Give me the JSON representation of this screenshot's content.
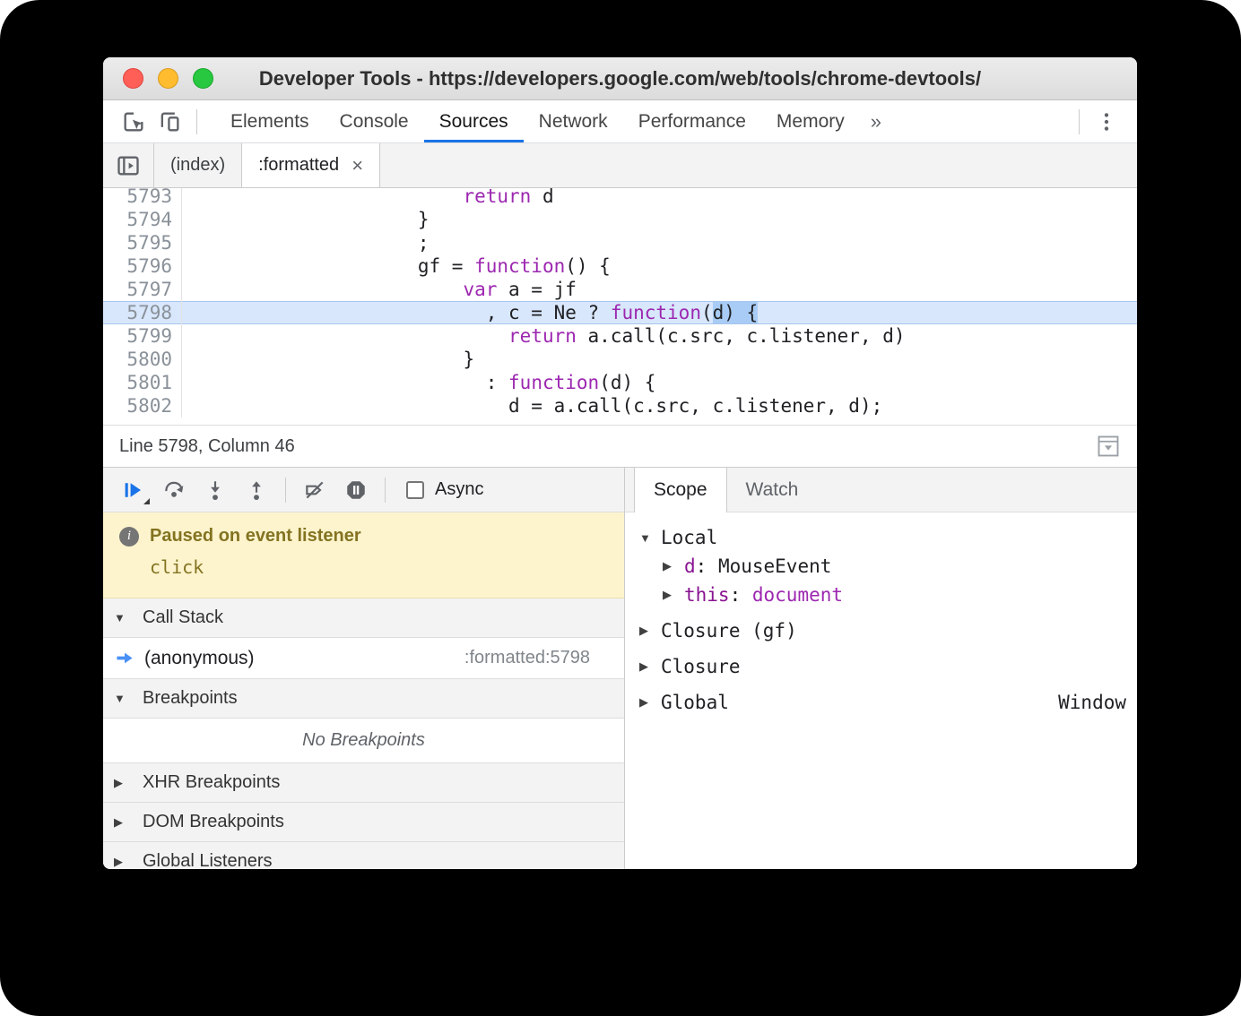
{
  "glyphs": {
    "triangle_down": "▼",
    "triangle_right": "▶",
    "close": "×",
    "overflow_chevron": "»",
    "kebab_menu": "⋮"
  },
  "colors": {
    "accent-blue": "#1a73e8",
    "icon-gray": "#5f6368",
    "keyword-purple": "#9c27b0",
    "scope-name-purple": "#881391",
    "exec-line-bg": "#d8e7fc",
    "exec-line-border": "#a6c5ec",
    "selection-bg": "#a8ccf5",
    "paused-bg": "#fdf4cd",
    "paused-border": "#e8dfae",
    "paused-text": "#837321"
  },
  "window": {
    "title": "Developer Tools - https://developers.google.com/web/tools/chrome-devtools/"
  },
  "main_toolbar": {
    "tabs": [
      {
        "label": "Elements",
        "active": false
      },
      {
        "label": "Console",
        "active": false
      },
      {
        "label": "Sources",
        "active": true
      },
      {
        "label": "Network",
        "active": false
      },
      {
        "label": "Performance",
        "active": false
      },
      {
        "label": "Memory",
        "active": false
      }
    ]
  },
  "file_tabs": [
    {
      "label": "(index)",
      "active": false,
      "closable": false
    },
    {
      "label": ":formatted",
      "active": true,
      "closable": true
    }
  ],
  "editor": {
    "lines": [
      {
        "n": "5793",
        "highlight": false,
        "tokens": [
          [
            "                        ",
            "p"
          ],
          [
            "return",
            "k"
          ],
          [
            " d",
            "p"
          ]
        ]
      },
      {
        "n": "5794",
        "highlight": false,
        "tokens": [
          [
            "                    ",
            "p"
          ],
          [
            "}",
            "p"
          ]
        ]
      },
      {
        "n": "5795",
        "highlight": false,
        "tokens": [
          [
            "                    ",
            "p"
          ],
          [
            ";",
            "p"
          ]
        ]
      },
      {
        "n": "5796",
        "highlight": false,
        "tokens": [
          [
            "                    ",
            "p"
          ],
          [
            "gf = ",
            "p"
          ],
          [
            "function",
            "k"
          ],
          [
            "() {",
            "p"
          ]
        ]
      },
      {
        "n": "5797",
        "highlight": false,
        "tokens": [
          [
            "                        ",
            "p"
          ],
          [
            "var",
            "k"
          ],
          [
            " a = jf",
            "p"
          ]
        ]
      },
      {
        "n": "5798",
        "highlight": true,
        "tokens": [
          [
            "                          ",
            "p"
          ],
          [
            ", c = Ne ? ",
            "p"
          ],
          [
            "function",
            "k"
          ],
          [
            "(",
            "p"
          ],
          [
            "d) {",
            "sel"
          ]
        ]
      },
      {
        "n": "5799",
        "highlight": false,
        "tokens": [
          [
            "                            ",
            "p"
          ],
          [
            "return",
            "k"
          ],
          [
            " a.call(c.src, c.listener, d)",
            "p"
          ]
        ]
      },
      {
        "n": "5800",
        "highlight": false,
        "tokens": [
          [
            "                        ",
            "p"
          ],
          [
            "}",
            "p"
          ]
        ]
      },
      {
        "n": "5801",
        "highlight": false,
        "tokens": [
          [
            "                          ",
            "p"
          ],
          [
            ": ",
            "p"
          ],
          [
            "function",
            "k"
          ],
          [
            "(d) {",
            "p"
          ]
        ]
      },
      {
        "n": "5802",
        "highlight": false,
        "tokens": [
          [
            "                            ",
            "p"
          ],
          [
            "d = a.call(c.src, c.listener, d);",
            "p"
          ]
        ]
      }
    ]
  },
  "status_bar": {
    "text": "Line 5798, Column 46"
  },
  "debugger_pane": {
    "async_label": "Async",
    "async_checked": false,
    "paused_message": {
      "title": "Paused on event listener",
      "detail": "click"
    },
    "call_stack": {
      "header": "Call Stack",
      "frames": [
        {
          "name": "(anonymous)",
          "location": ":formatted:5798",
          "current": true
        }
      ]
    },
    "breakpoints": {
      "header": "Breakpoints",
      "empty_message": "No Breakpoints"
    },
    "collapsed_sections": [
      "XHR Breakpoints",
      "DOM Breakpoints",
      "Global Listeners"
    ]
  },
  "scope_pane": {
    "tabs": [
      {
        "label": "Scope",
        "active": true
      },
      {
        "label": "Watch",
        "active": false
      }
    ],
    "tree": [
      {
        "level": 0,
        "expanded": true,
        "parts": [
          [
            "Local",
            "plain"
          ]
        ]
      },
      {
        "level": 1,
        "expanded": false,
        "parts": [
          [
            "d",
            "name"
          ],
          [
            ": ",
            "plain"
          ],
          [
            "MouseEvent",
            "plain"
          ]
        ]
      },
      {
        "level": 1,
        "expanded": false,
        "parts": [
          [
            "this",
            "name"
          ],
          [
            ": ",
            "plain"
          ],
          [
            "document",
            "value"
          ]
        ]
      },
      {
        "level": 0,
        "expanded": false,
        "parts": [
          [
            "Closure (gf)",
            "plain"
          ]
        ]
      },
      {
        "level": 0,
        "expanded": false,
        "parts": [
          [
            "Closure",
            "plain"
          ]
        ]
      },
      {
        "level": 0,
        "expanded": false,
        "parts": [
          [
            "Global",
            "plain"
          ]
        ],
        "right_value": "Window"
      }
    ]
  }
}
